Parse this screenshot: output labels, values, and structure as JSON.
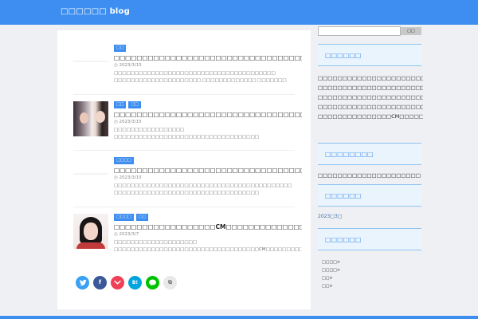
{
  "header": {
    "site_title": "□□□□□□ blog"
  },
  "articles": [
    {
      "cats": [
        "□□"
      ],
      "title": "□□□□□□□□□□□□□□□□□□□□□□□□□□□□□□□□□□○○□□□",
      "date": "◷ 2023/3/15",
      "excerpt": "□□□□□□□□□□□□□□□□□□□□□□□□□□□□□□□□□□□□□□□ □□□□□□□□□□□□□□□□□□□□□ □□□□□□□□□□□□□ □□□□□□□ □□□□□□□□□□□□□□ □□□□□□□□□□□□□ ..."
    },
    {
      "cats": [
        "□□",
        "□□"
      ],
      "title": "□□□□□□□□□□□□□□□□□□□□□□□□□□□□□□□□□□□□□□□□□□□□□□□□□",
      "date": "◷ 2023/3/15",
      "excerpt": "□□□□□□□□□□□□□□□□□ □□□□□□□□□□□□□□□□□□□□□□□□□□□□□□□□□□□ □□□□□□□□□□□□□□□□□□□□□□ □□ □□□□□□□□□□□□□□□□□□□□□□□□ □□□□□□□□□□□□□ ..."
    },
    {
      "cats": [
        "□□□□"
      ],
      "title": "□□□□□□□□□□□□□□□□□□□□□□□□□□□□□□□□□□□□□□□□□□□□□□□□",
      "date": "◷ 2023/3/15",
      "excerpt": "□□□□□□□□□□□□□□□□□□□□□□□□□□□□□□□□□□□□□□□□□□□ □□□□□□□□□□□□□□□□□□□□□□□□□□□□□□□□□□□ □□□□□□□□□□□□□□□□□□□□□□□ □□□□□□□2018□ ..."
    },
    {
      "cats": [
        "□□□□",
        "□□"
      ],
      "title": "□□□□□□□□□□□□□□□□□□CM□□□□□□□□□□□□□□□□□□□□□□□□",
      "date": "◷ 2023/3/7",
      "excerpt": "□□□□□□□□□□□□□□□□□□□□ □□□□□□□□□□□□□□□□□□□□□□□□□□□□□□□□□□□CM□□□□□□□□□□□□□□□□□□ □□□□□□□□□□□□□□□□□□□□□□□□□□□□□□□□□□□□□□□□□ ..."
    }
  ],
  "share": {
    "tw": "",
    "fb": "f",
    "pk": "",
    "hb": "B!",
    "ln": "",
    "cp": "⧉"
  },
  "sidebar": {
    "search_button": "□□",
    "recent_heading": "□□□□□□",
    "recent_posts": [
      "□□□□□□□□□□□□□□□□□□□□□□□□□□□□○○□□□",
      "□□□□□□□□□□□□□□□□□□□□□□□□□□□□□□□□□□□□",
      "□□□□□□□□□□□□□□□□□□□□□□□□□□□□□□□□□□□□",
      "□□□□□□□□□□□□□□□□□□□□□□□□□□□□□□□□□□□",
      "□□□□□□□□□□□□□□□CM□□□□□□□□□□□□□□□□□□"
    ],
    "comments_heading": "□□□□□□□□",
    "comments_text": "□□□□□□□□□□□□□□□□□□□□□",
    "archive_heading": "□□□□□□",
    "archive_link": "2023□3□",
    "category_heading": "□□□□□□",
    "categories": [
      "□□□□>",
      "□□□□>",
      "□□>",
      "□□>"
    ]
  }
}
